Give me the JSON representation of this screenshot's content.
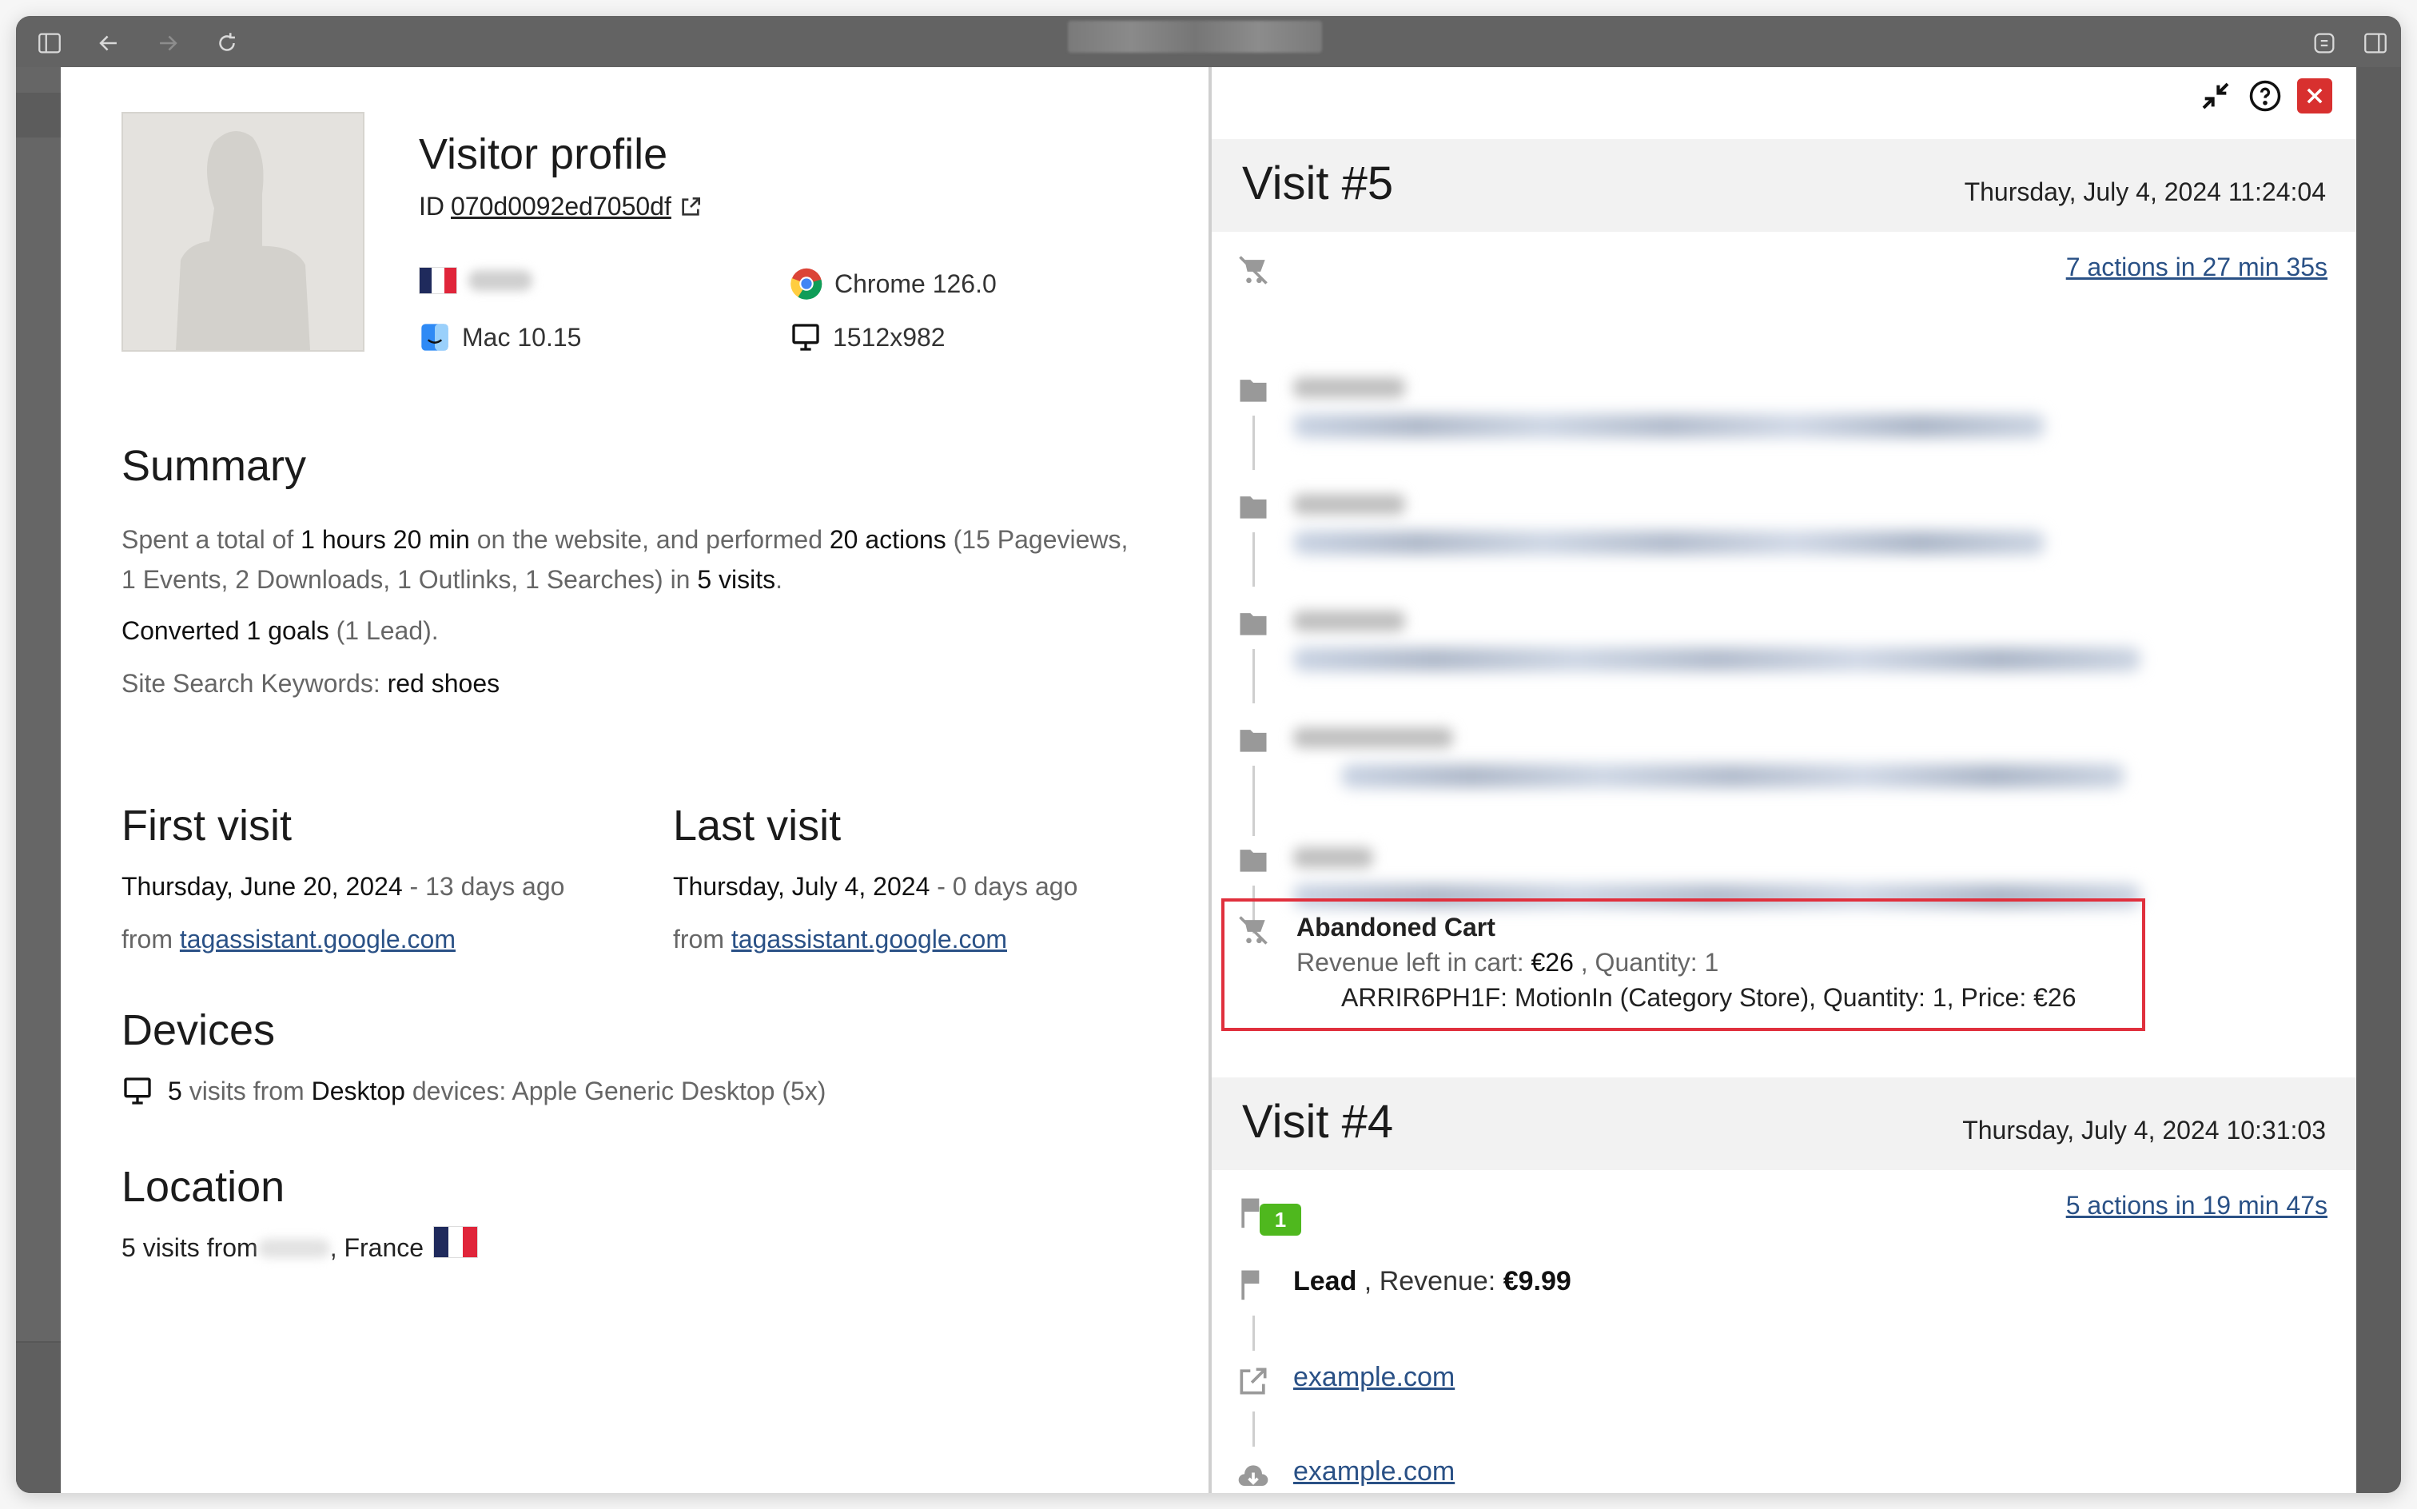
{
  "browser": {
    "address_blurred": true,
    "icons": [
      "sidebar-icon",
      "back-icon",
      "forward-icon",
      "reload-icon",
      "extensions-icon",
      "split-view-icon"
    ]
  },
  "profile": {
    "title": "Visitor profile",
    "id_label": "ID",
    "id_value": "070d0092ed7050df",
    "country_flag": "France",
    "city_blurred": true,
    "browser": "Chrome 126.0",
    "os": "Mac 10.15",
    "resolution": "1512x982"
  },
  "summary": {
    "heading": "Summary",
    "line1_a": "Spent a total of ",
    "line1_b": "1 hours 20 min",
    "line1_c": " on the website, and performed ",
    "line1_d": "20 actions",
    "line1_e": " (15 Pageviews,",
    "line2_a": "1 Events, 2 Downloads, 1 Outlinks, 1 Searches) in ",
    "line2_b": "5 visits",
    "line2_c": ".",
    "goals_a": "Converted 1 goals",
    "goals_b": " (1 Lead).",
    "keywords_label": "Site Search Keywords: ",
    "keywords_value": "red shoes"
  },
  "first_visit": {
    "heading": "First visit",
    "date": "Thursday, June 20, 2024",
    "ago": " - 13 days ago",
    "from": "from ",
    "referrer": "tagassistant.google.com"
  },
  "last_visit": {
    "heading": "Last visit",
    "date": "Thursday, July 4, 2024",
    "ago": " - 0 days ago",
    "from": "from ",
    "referrer": "tagassistant.google.com"
  },
  "devices": {
    "heading": "Devices",
    "a": "5",
    "b": " visits from ",
    "c": "Desktop",
    "d": " devices: Apple Generic Desktop (5x)"
  },
  "location": {
    "heading": "Location",
    "a": "5 visits from ",
    "b": ", France"
  },
  "visits": [
    {
      "title": "Visit #5",
      "datetime": "Thursday, July 4, 2024 11:24:04",
      "actions_link": "7 actions in 27 min 35s",
      "abandoned_cart": {
        "title": "Abandoned Cart",
        "revenue_label": "Revenue left in cart: ",
        "revenue": "€26",
        "quantity": " , Quantity: 1",
        "item": "ARRIR6PH1F: MotionIn (Category Store), Quantity: 1, Price: €26"
      }
    },
    {
      "title": "Visit #4",
      "datetime": "Thursday, July 4, 2024 10:31:03",
      "actions_link": "5 actions in 19 min 47s",
      "goal_badge": "1",
      "goal_name": "Lead",
      "goal_revenue_label": " , Revenue: ",
      "goal_revenue": "€9.99",
      "outlink": "example.com",
      "download": "example.com"
    }
  ],
  "colors": {
    "link": "#2a5186",
    "close": "#d8302f",
    "highlight": "#e0303d",
    "goal_badge": "#4fb81e"
  }
}
